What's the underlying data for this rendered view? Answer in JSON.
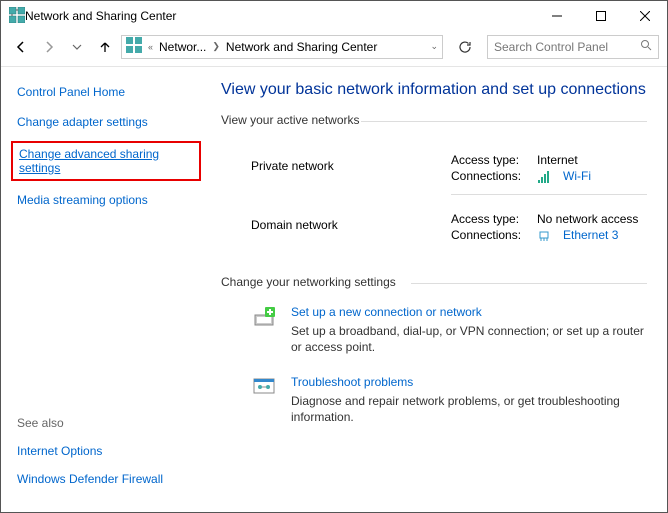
{
  "window": {
    "title": "Network and Sharing Center"
  },
  "breadcrumb": {
    "item1": "Networ...",
    "item2": "Network and Sharing Center"
  },
  "search": {
    "placeholder": "Search Control Panel"
  },
  "sidebar": {
    "home": "Control Panel Home",
    "adapter": "Change adapter settings",
    "advanced": "Change advanced sharing settings",
    "streaming": "Media streaming options",
    "seealso_label": "See also",
    "internet_options": "Internet Options",
    "firewall": "Windows Defender Firewall"
  },
  "main": {
    "title": "View your basic network information and set up connections",
    "active_networks_header": "View your active networks",
    "private": {
      "name": "Private network",
      "access_label": "Access type:",
      "access_value": "Internet",
      "conn_label": "Connections:",
      "conn_value": "Wi-Fi"
    },
    "domain": {
      "name": "Domain network",
      "access_label": "Access type:",
      "access_value": "No network access",
      "conn_label": "Connections:",
      "conn_value": "Ethernet 3"
    },
    "change_header": "Change your networking settings",
    "setup": {
      "title": "Set up a new connection or network",
      "desc": "Set up a broadband, dial-up, or VPN connection; or set up a router or access point."
    },
    "troubleshoot": {
      "title": "Troubleshoot problems",
      "desc": "Diagnose and repair network problems, or get troubleshooting information."
    }
  }
}
